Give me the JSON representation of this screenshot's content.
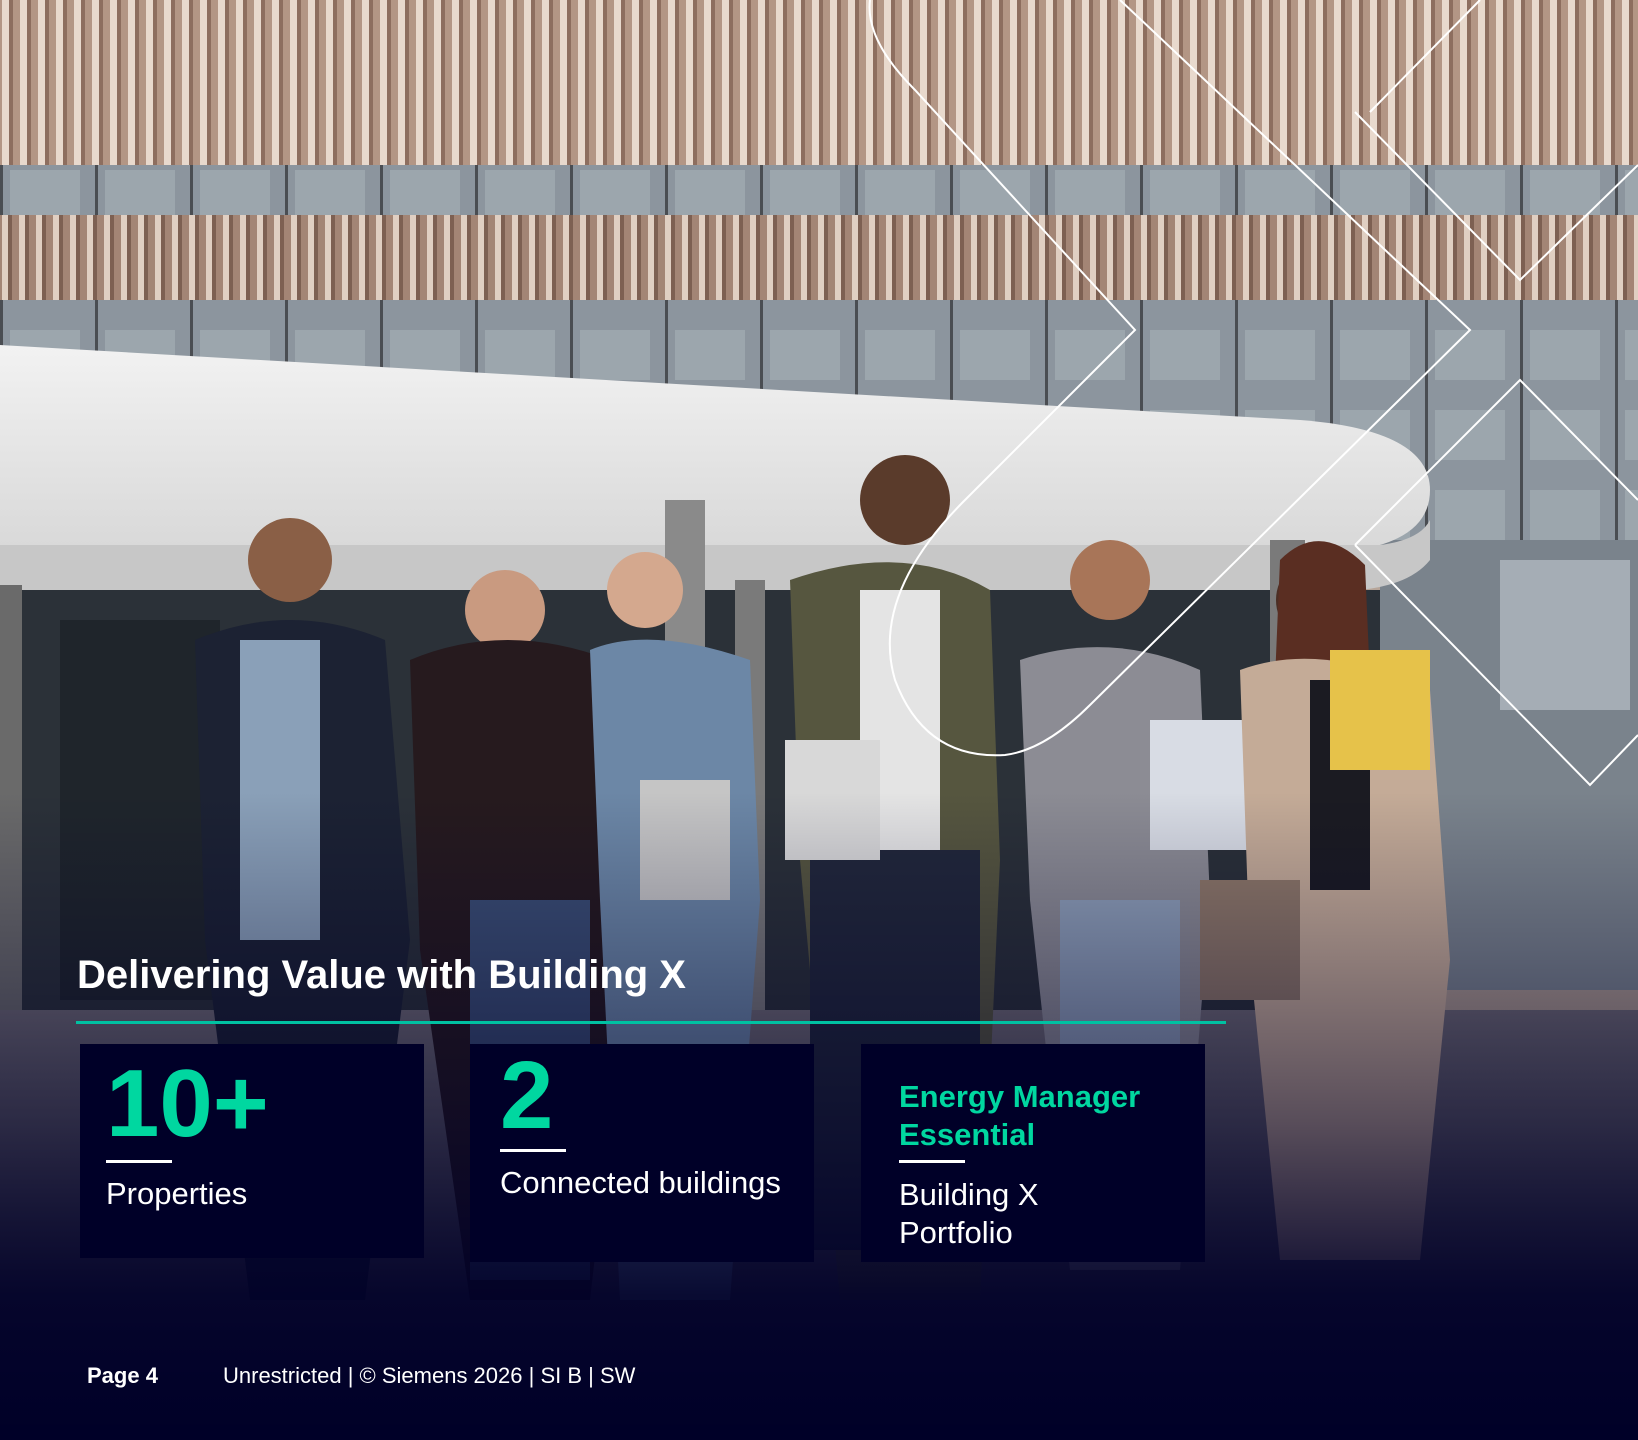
{
  "slide": {
    "title": "Delivering Value with Building X",
    "accent_color": "#00d7a0",
    "rule_color": "#00c1a2",
    "background_color": "#000028"
  },
  "kpis": [
    {
      "value": "10+",
      "label": "Properties"
    },
    {
      "value": "2",
      "label": "Connected buildings"
    },
    {
      "value": "Energy Manager Essential",
      "label": "Building X Portfolio"
    }
  ],
  "footer": {
    "page": "Page 4",
    "classification": "Unrestricted | © Siemens 2026 | SI B | SW"
  },
  "background_image": {
    "subject": "group-of-students-walking-outside-modern-building"
  }
}
